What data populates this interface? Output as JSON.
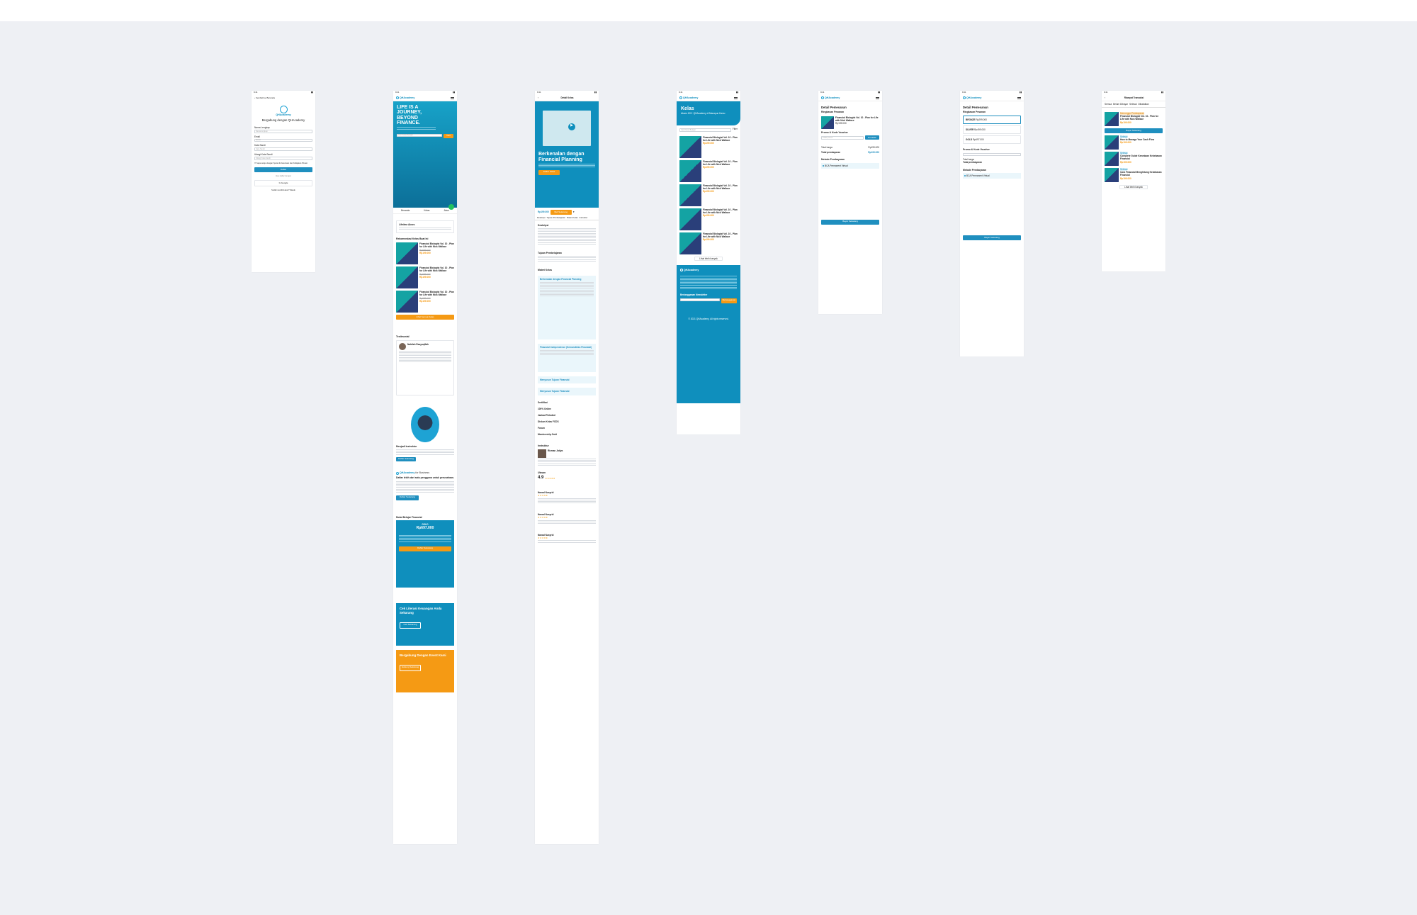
{
  "colors": {
    "accent": "#1f8fbf",
    "brand": "#0e8fbd",
    "cta": "#f59a14",
    "bg": "#eef0f4"
  },
  "status": {
    "time": "9:41"
  },
  "brand": {
    "name": "QHAcademy"
  },
  "s1": {
    "back": "Kembali ke Beranda",
    "title": "Bergabung dengan QHAcademy",
    "fields": [
      {
        "label": "Nama Lengkap",
        "placeholder": "Nama lengkap"
      },
      {
        "label": "Email",
        "placeholder": "Email"
      },
      {
        "label": "Kata Sandi",
        "placeholder": "Kata Sandi"
      },
      {
        "label": "Ulangi Kata Sandi",
        "placeholder": "Ulangi Kata Sandi"
      }
    ],
    "terms": "Saya setuju dengan Syarat & Ketentuan dan Kebijakan Privasi",
    "submit": "Daftar",
    "or": "Atau daftar dengan",
    "google": "Google",
    "login": "Sudah memiliki akun? Masuk"
  },
  "s2": {
    "hero_title": "LIFE IS A JOURNEY, BEYOND FINANCE.",
    "search_placeholder": "Cari Kelas Belajar",
    "search_btn": "Cari",
    "tabs": [
      "Beranda",
      "Kelas",
      "Akun"
    ],
    "feature": "Lifetime Akses",
    "rec_title": "Rekomendasi Kelas Buat Ini",
    "courses": [
      {
        "title": "Financial Biologist Vol. 10 - Plan for Life with Nick Wallace",
        "old": "Rp699.000",
        "price": "Rp199.000"
      },
      {
        "title": "Financial Biologist Vol. 10 - Plan for Life with Nick Wallace",
        "old": "Rp699.000",
        "price": "Rp199.000"
      },
      {
        "title": "Financial Biologist Vol. 10 - Plan for Life with Nick Wallace",
        "old": "Rp699.000",
        "price": "Rp199.000"
      }
    ],
    "more_btn": "Lihat Semua Kelas",
    "testimonial_title": "Testimonial",
    "testi_name": "Nabilah Rasyaqillah",
    "instructor_title": "Menjadi Instruktur",
    "instructor_btn": "Daftar Sekarang",
    "biz_title": "Daftar lebih dari satu pengguna untuk perusahaan.",
    "biz_suffix": "for Business",
    "biz_btn": "Daftar Sekarang",
    "start_title": "Mulai Belajar Financial",
    "plan": {
      "name": "GOLD",
      "price": "Rp697.000",
      "btn": "Daftar Sekarang"
    },
    "cek_title": "Cek Literasi Keuangan Anda Sekarang",
    "cek_btn": "Cek Sekarang",
    "expert_title": "Bergabung Dengan Event Kami",
    "expert_btn": "Gabung Sekarang"
  },
  "s3": {
    "header": "Detail Kelas",
    "title": "Berkenalan dengan Financial Planning",
    "cta": "Daftar Kelas",
    "price": "Rp199.000",
    "buy": "Beli Sekarang",
    "tabs": [
      "Deskripsi",
      "Tujuan Pembelajaran",
      "Materi Kelas",
      "Instruktur"
    ],
    "desc_title": "Deskripsi",
    "goal_title": "Tujuan Pembelajaran",
    "materi_title": "Materi Kelas",
    "sections": [
      "Berkenalan dengan Financial Planning",
      "Financial Independence (Kemandirian Finansial)",
      "Menyusun Tujuan Finansial",
      "Menyusun Tujuan Finansial"
    ],
    "perks": [
      "Sertifikat",
      "100% Online",
      "Jadwal Fleksibel",
      "Diskon Kelas FCDS",
      "Forum",
      "Membership Gold"
    ],
    "instr_title": "Instruktur",
    "instr_name": "Rizman Jatiya",
    "review_title": "Ulasan",
    "rating": "4.9",
    "reviewer": "Nanad Nusyrid"
  },
  "s4": {
    "title": "Kelas",
    "subtitle": "Akses 100+ QHAcademy di Manapun Kamu",
    "search_placeholder": "Cari Kelas Belajar",
    "filter": "Filter",
    "courses": [
      {
        "title": "Financial Biologist Vol. 10 - Plan for Life with Nick Wallace",
        "price": "Rp199.000"
      },
      {
        "title": "Financial Biologist Vol. 10 - Plan for Life with Nick Wallace",
        "price": "Rp199.000"
      },
      {
        "title": "Financial Biologist Vol. 10 - Plan for Life with Nick Wallace",
        "price": "Rp199.000"
      },
      {
        "title": "Financial Biologist Vol. 10 - Plan for Life with Nick Wallace",
        "price": "Rp199.000"
      },
      {
        "title": "Financial Biologist Vol. 10 - Plan for Life with Nick Wallace",
        "price": "Rp199.000"
      }
    ],
    "more": "Lihat lebih banyak",
    "footer_brand": "QHAcademy",
    "newsletter": "Berlangganan Newsletter",
    "newsletter_btn": "Berlangganan",
    "copyright": "© 2021 QHAcademy. All rights reserved."
  },
  "s5": {
    "title": "Detail Pemesanan",
    "order_label": "Ringkasan Pesanan",
    "item": "Financial Biologist Vol. 10 - Plan for Life with Nick Wallace",
    "item_price": "Rp199.000",
    "promo_label": "Promo & Kode Voucher",
    "promo_placeholder": "Kode promo",
    "promo_btn": "Gunakan",
    "total_label": "Total harga",
    "total": "Rp199.000",
    "grand_label": "Total pembayaran",
    "grand": "Rp199.000",
    "method_label": "Metode Pembayaran",
    "method_sel": "BCA Permanent Virtual",
    "pay_btn": "Bayar Sekarang"
  },
  "s6": {
    "title": "Detail Pemesanan",
    "order_label": "Ringkasan Pesanan",
    "plans": [
      {
        "name": "BRONZE",
        "price": "Rp299.000"
      },
      {
        "name": "SILVER",
        "price": "Rp499.000"
      },
      {
        "name": "GOLD",
        "price": "Rp697.000"
      }
    ],
    "promo_label": "Promo & Kode Voucher",
    "total_label": "Total harga",
    "grand_label": "Total pembayaran",
    "method_label": "Metode Pembayaran",
    "method_sel": "BCA Permanent Virtual",
    "pay_btn": "Bayar Sekarang"
  },
  "s7": {
    "title": "Riwayat Transaksi",
    "tabs": [
      "Semua",
      "Belum Dibayar",
      "Selesai",
      "Dibatalkan"
    ],
    "items": [
      {
        "badge": "Menunggu Pembayaran",
        "title": "Financial Biologist Vol. 10 - Plan for Life with Nick Wallace",
        "price": "Rp199.000",
        "btn": "Bayar Sekarang"
      },
      {
        "badge": "Selesai",
        "title": "How to Manage Your Cash Flow",
        "price": "Rp199.000"
      },
      {
        "badge": "Selesai",
        "title": "Complete Guide Kenrataan Kebebasan Financial",
        "price": "Rp199.000"
      },
      {
        "badge": "Selesai",
        "title": "Cara Financial Menghitung Kebebasan Financial",
        "price": "Rp199.000"
      }
    ],
    "more": "Lihat lebih banyak"
  }
}
